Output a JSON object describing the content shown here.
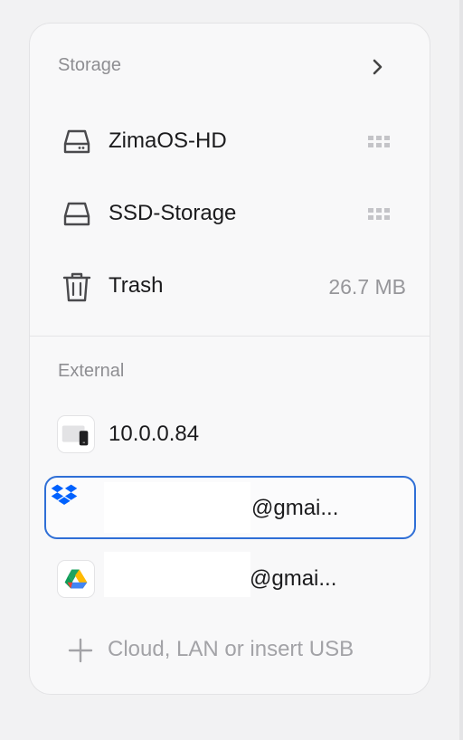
{
  "storage": {
    "title": "Storage",
    "items": [
      {
        "label": "ZimaOS-HD",
        "icon": "hard-drive-icon",
        "meta_icon": "grid-dots-icon"
      },
      {
        "label": "SSD-Storage",
        "icon": "hard-drive-icon",
        "meta_icon": "grid-dots-icon"
      },
      {
        "label": "Trash",
        "icon": "trash-icon",
        "size": "26.7 MB"
      }
    ]
  },
  "external": {
    "title": "External",
    "items": [
      {
        "label": "10.0.0.84",
        "icon": "network-share-icon"
      },
      {
        "label": "@gmai...",
        "icon": "dropbox-icon",
        "selected": true
      },
      {
        "label": "@gmai...",
        "icon": "google-drive-icon"
      }
    ],
    "add_label": "Cloud, LAN or insert USB"
  },
  "colors": {
    "accent": "#2f6fd6",
    "panel_bg": "#f8f8f9",
    "text": "#1b1b1d",
    "muted": "#8e8e92"
  }
}
